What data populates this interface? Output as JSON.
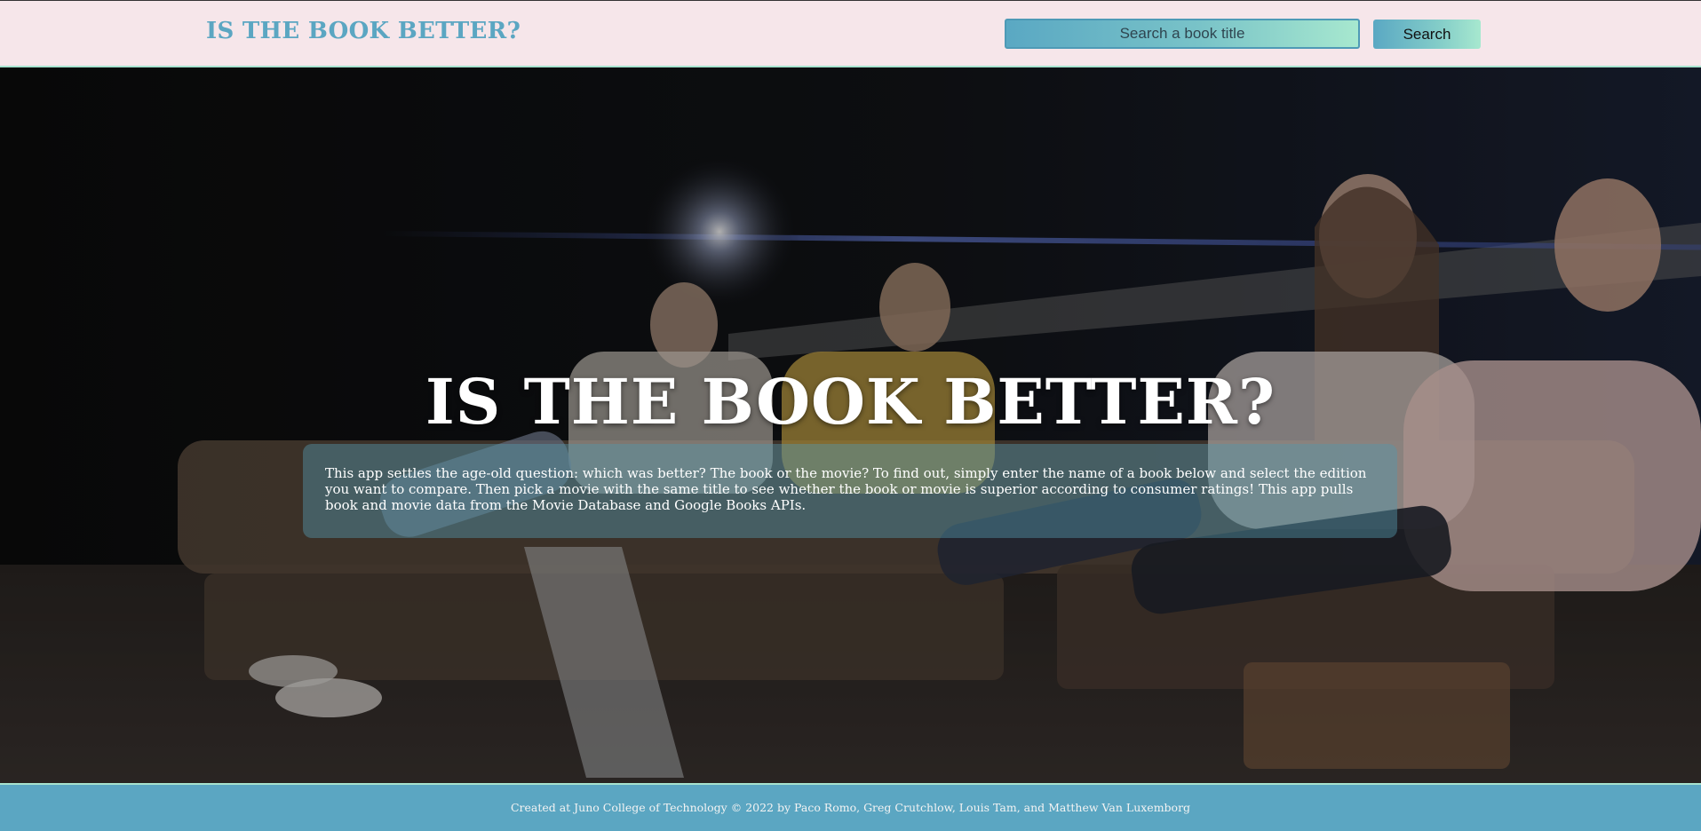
{
  "header": {
    "brand": "IS THE BOOK BETTER?",
    "search": {
      "placeholder": "Search a book title",
      "value": ""
    },
    "search_button_label": "Search"
  },
  "hero": {
    "background_image": "movie-theater-audience-photo",
    "title": "IS THE BOOK BETTER?",
    "intro": "This app settles the age-old question: which was better? The book or the movie? To find out, simply enter the name of a book below and select the edition you want to compare. Then pick a movie with the same title to see whether the book or movie is superior according to consumer ratings! This app pulls book and movie data from the Movie Database and Google Books APIs."
  },
  "footer": {
    "credits": "Created at Juno College of Technology © 2022 by Paco Romo, Greg Crutchlow, Louis Tam, and Matthew Van Luxemborg"
  },
  "colors": {
    "header_bg": "#f6e6ea",
    "brand": "#5ba6c2",
    "accent_mint": "#a7e8cf",
    "footer_bg": "#5ba6c2"
  }
}
